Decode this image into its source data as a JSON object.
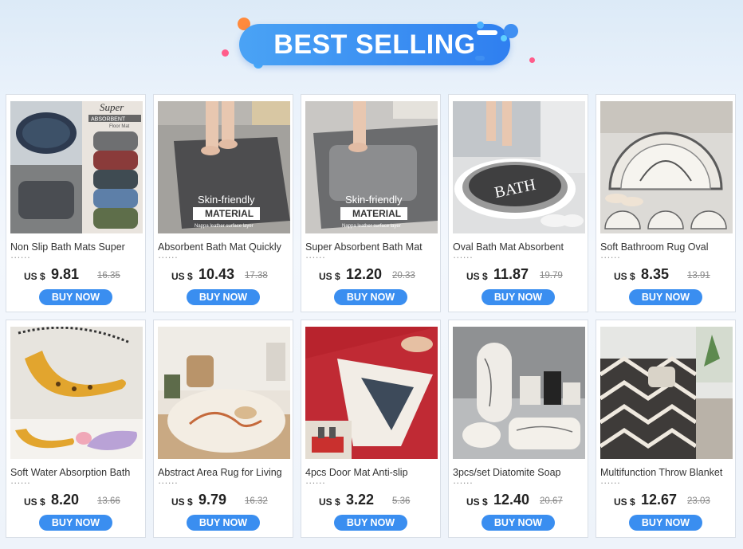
{
  "banner": {
    "title": "BEST SELLING"
  },
  "colors": {
    "accent": "#3a8ef0",
    "banner_blue": "#2f7ff0",
    "dot_orange": "#ff8a3d",
    "dot_pink": "#ff5c8a"
  },
  "products": [
    {
      "name": "Non Slip Bath Mats Super",
      "currency": "US $",
      "price": "9.81",
      "old_price": "16.35",
      "button": "BUY NOW",
      "image_text": "Super ABSORBENT Floor Mat"
    },
    {
      "name": "Absorbent Bath Mat Quickly",
      "currency": "US $",
      "price": "10.43",
      "old_price": "17.38",
      "button": "BUY NOW",
      "image_text": "Skin-friendly MATERIAL"
    },
    {
      "name": "Super Absorbent Bath Mat",
      "currency": "US $",
      "price": "12.20",
      "old_price": "20.33",
      "button": "BUY NOW",
      "image_text": "Skin-friendly MATERIAL"
    },
    {
      "name": "Oval Bath Mat Absorbent",
      "currency": "US $",
      "price": "11.87",
      "old_price": "19.79",
      "button": "BUY NOW",
      "image_text": "BATH"
    },
    {
      "name": "Soft Bathroom Rug Oval",
      "currency": "US $",
      "price": "8.35",
      "old_price": "13.91",
      "button": "BUY NOW",
      "image_text": ""
    },
    {
      "name": "Soft Water Absorption Bath",
      "currency": "US $",
      "price": "8.20",
      "old_price": "13.66",
      "button": "BUY NOW",
      "image_text": ""
    },
    {
      "name": "Abstract Area Rug for Living",
      "currency": "US $",
      "price": "9.79",
      "old_price": "16.32",
      "button": "BUY NOW",
      "image_text": ""
    },
    {
      "name": "4pcs Door Mat Anti-slip",
      "currency": "US $",
      "price": "3.22",
      "old_price": "5.36",
      "button": "BUY NOW",
      "image_text": ""
    },
    {
      "name": "3pcs/set Diatomite Soap",
      "currency": "US $",
      "price": "12.40",
      "old_price": "20.67",
      "button": "BUY NOW",
      "image_text": ""
    },
    {
      "name": "Multifunction Throw Blanket",
      "currency": "US $",
      "price": "12.67",
      "old_price": "23.03",
      "button": "BUY NOW",
      "image_text": ""
    }
  ]
}
